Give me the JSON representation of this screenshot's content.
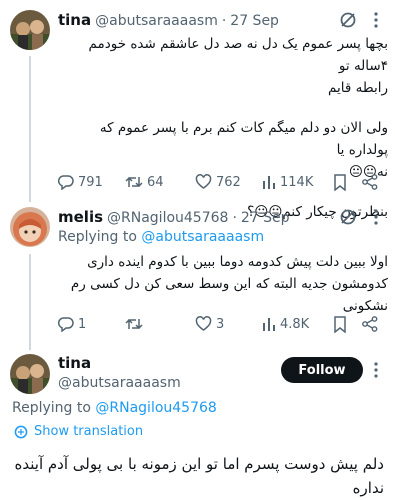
{
  "tweet1": {
    "name": "tina",
    "handle": "@abutsaraaaasm",
    "separator": "·",
    "date": "27 Sep",
    "lines": [
      "بچها پسر عموم یک دل نه صد دل عاشقم شده خودمم ۴ساله تو",
      "رابطه قایم",
      "ولی الان دو دلم میگم کات کنم برم با پسر عموم که پولداره  یا",
      "نه😐😐",
      "بنظرتون چیکار کنم😐😐؟"
    ],
    "stats": {
      "replies": "791",
      "retweets": "64",
      "likes": "762",
      "views": "114K"
    }
  },
  "tweet2": {
    "name": "melis",
    "handle": "@RNagilou45768",
    "separator": "·",
    "date": "27 Sep",
    "replying_label": "Replying to",
    "replying_to": "@abutsaraaaasm",
    "lines": [
      "اولا ببین دلت پیش کدومه دوما ببین با کدوم اینده داری",
      "کدومشون جدیه البته که این وسط سعی کن دل کسی رم",
      "نشکونی"
    ],
    "stats": {
      "replies": "1",
      "retweets": "",
      "likes": "3",
      "views": "4.8K"
    }
  },
  "tweet3": {
    "name": "tina",
    "handle": "@abutsaraaaasm",
    "follow_label": "Follow",
    "replying_label": "Replying to",
    "replying_to": "@RNagilou45768",
    "show_translation": "Show translation",
    "lines": [
      "دلم پیش دوست پسرم اما تو این زمونه با بی پولی آدم آینده",
      "نداره"
    ]
  },
  "colors": {
    "accent": "#1d9bf0",
    "text": "#0f1419",
    "muted": "#536471",
    "line": "#cfd9de"
  }
}
